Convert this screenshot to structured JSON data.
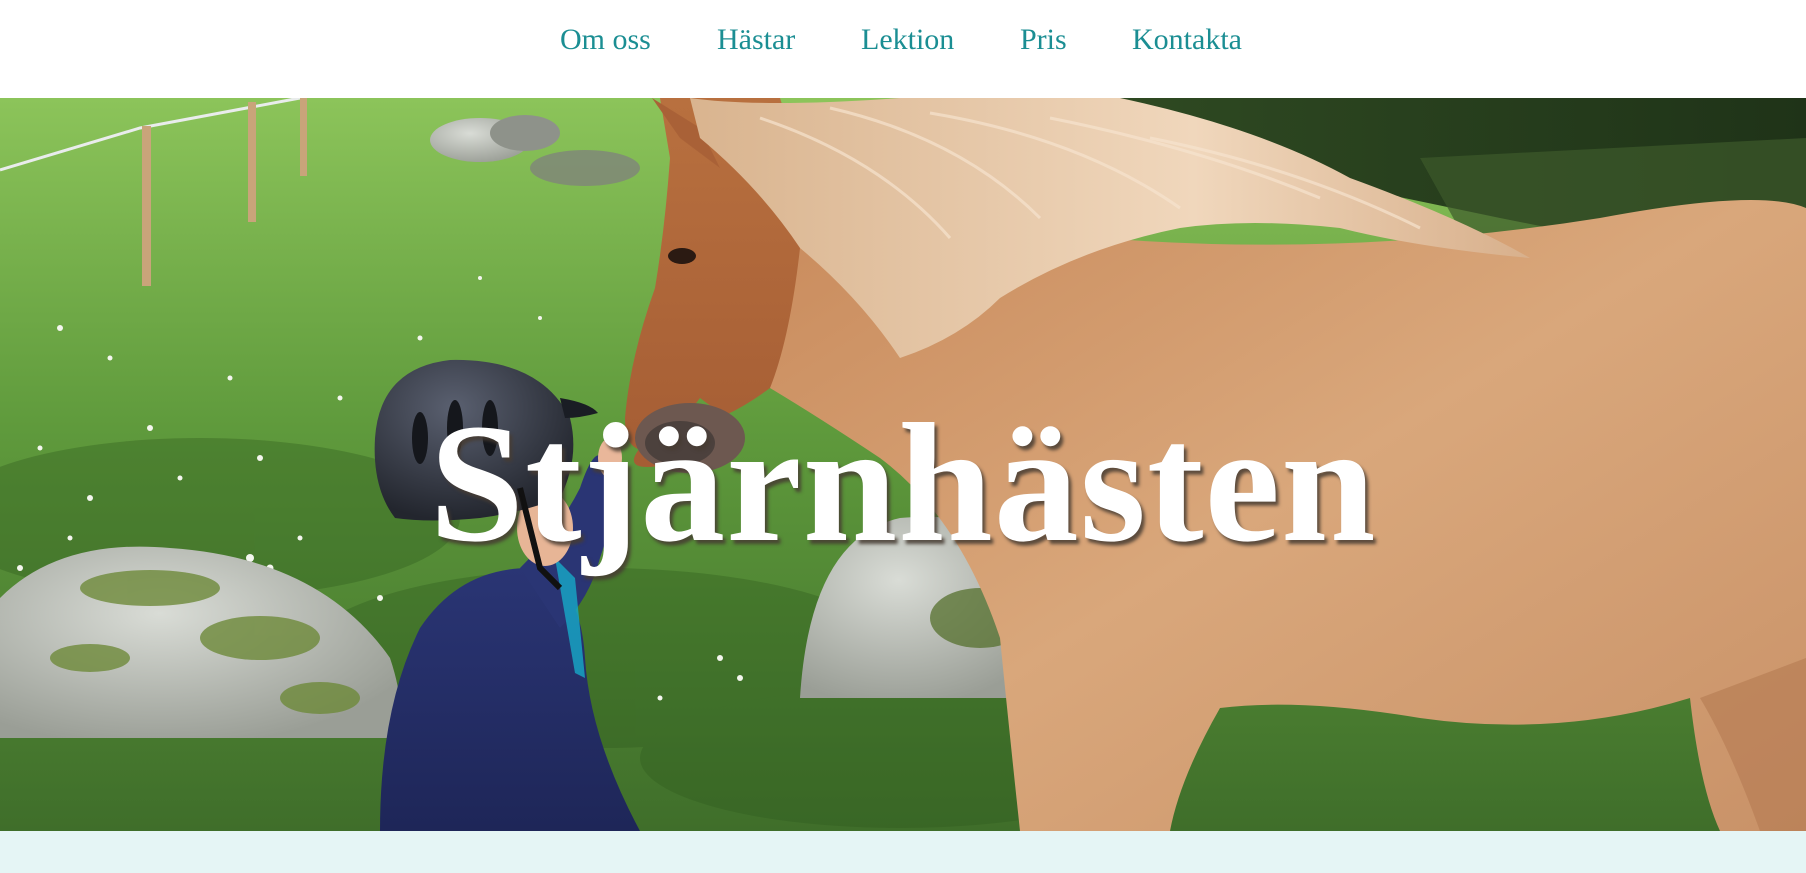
{
  "nav": {
    "items": [
      {
        "label": "Om oss"
      },
      {
        "label": "Hästar"
      },
      {
        "label": "Lektion"
      },
      {
        "label": "Pris"
      },
      {
        "label": "Kontakta"
      }
    ]
  },
  "hero": {
    "title": "Stjärnhästen"
  },
  "colors": {
    "nav_link": "#1b8e93",
    "footer_band": "#e5f5f5",
    "title_text": "#ffffff"
  }
}
